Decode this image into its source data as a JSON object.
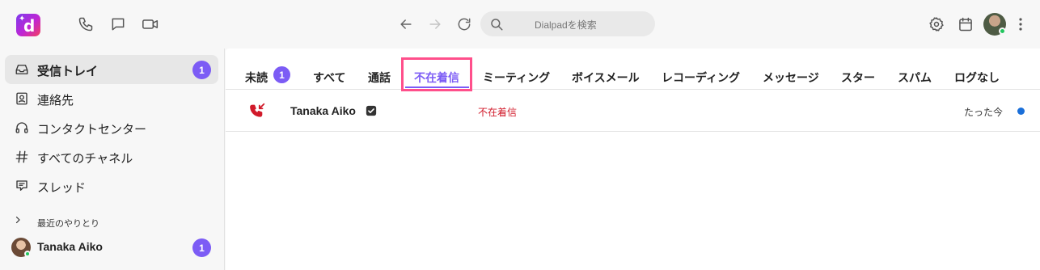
{
  "app": {
    "logo_letter": "d",
    "brand_color": "#7c5cf5"
  },
  "topbar": {
    "icons": [
      "phone-icon",
      "chat-icon",
      "video-icon",
      "back-arrow-icon",
      "forward-arrow-icon",
      "refresh-icon",
      "search-icon",
      "settings-icon",
      "calendar-icon",
      "more-icon"
    ],
    "search": {
      "placeholder": "Dialpadを検索"
    }
  },
  "sidebar": {
    "items": [
      {
        "label": "受信トレイ",
        "badge": "1",
        "icon": "inbox-icon",
        "active": true
      },
      {
        "label": "連絡先",
        "icon": "contact-card-icon"
      },
      {
        "label": "コンタクトセンター",
        "icon": "headset-icon"
      },
      {
        "label": "すべてのチャネル",
        "icon": "hash-icon"
      },
      {
        "label": "スレッド",
        "icon": "thread-icon"
      }
    ],
    "recent": {
      "section_label": "最近のやりとり",
      "contact": {
        "name": "Tanaka Aiko",
        "badge": "1"
      }
    }
  },
  "tabs": [
    {
      "label": "未読",
      "badge": "1"
    },
    {
      "label": "すべて"
    },
    {
      "label": "通話"
    },
    {
      "label": "不在着信",
      "active": true
    },
    {
      "label": "ミーティング"
    },
    {
      "label": "ボイスメール"
    },
    {
      "label": "レコーディング"
    },
    {
      "label": "メッセージ"
    },
    {
      "label": "スター"
    },
    {
      "label": "スパム"
    },
    {
      "label": "ログなし"
    }
  ],
  "rows": [
    {
      "name": "Tanaka Aiko",
      "status": "不在着信",
      "time": "たった今",
      "unread": true,
      "status_color": "#d11a2a"
    }
  ]
}
